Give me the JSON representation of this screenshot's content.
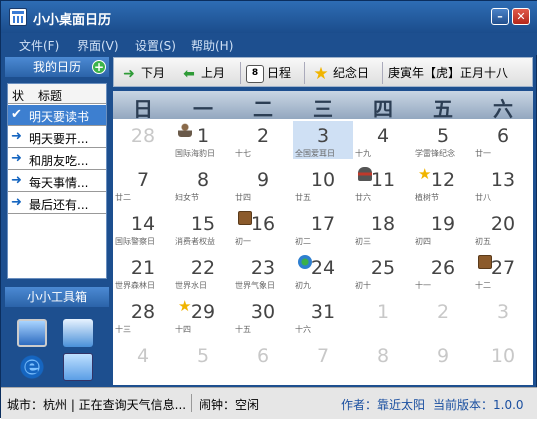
{
  "window": {
    "title": "小小桌面日历"
  },
  "menu": [
    "文件(F)",
    "界面(V)",
    "设置(S)",
    "帮助(H)"
  ],
  "my_calendar": {
    "header": "我的日历",
    "columns": [
      "状",
      "标题"
    ],
    "items": [
      {
        "status": "check-icon",
        "title": "明天要读书",
        "selected": true
      },
      {
        "status": "arrow-icon",
        "title": "明天要开..."
      },
      {
        "status": "arrow-icon",
        "title": "和朋友吃..."
      },
      {
        "status": "arrow-icon",
        "title": "每天事情..."
      },
      {
        "status": "arrow-icon",
        "title": "最后还有..."
      }
    ]
  },
  "toolbox": {
    "header": "小小工具箱",
    "tools": [
      "monitor-icon",
      "control-panel-icon",
      "ie-icon",
      "window-icon",
      "color-cubes-icon",
      "chart-monitor-icon"
    ]
  },
  "toolbar": {
    "next_month": "下月",
    "prev_month": "上月",
    "schedule": "日程",
    "schedule_icon_text": "8",
    "anniversary": "纪念日",
    "lunar_header": "庚寅年【虎】正月十八"
  },
  "weekdays": [
    "日",
    "一",
    "二",
    "三",
    "四",
    "五",
    "六"
  ],
  "calendar": {
    "weeks": [
      [
        {
          "d": "28",
          "o": true
        },
        {
          "d": "1",
          "l": "国际海豹日",
          "m": "person"
        },
        {
          "d": "2",
          "l": "十七"
        },
        {
          "d": "3",
          "l": "全国爱耳日",
          "today": true
        },
        {
          "d": "4",
          "l": "十九"
        },
        {
          "d": "5",
          "l": "学雷锋纪念"
        },
        {
          "d": "6",
          "l": "廿一"
        }
      ],
      [
        {
          "d": "7",
          "l": "廿二"
        },
        {
          "d": "8",
          "l": "妇女节"
        },
        {
          "d": "9",
          "l": "廿四"
        },
        {
          "d": "10",
          "l": "廿五"
        },
        {
          "d": "11",
          "l": "廿六",
          "m": "hat"
        },
        {
          "d": "12",
          "l": "植树节",
          "m": "star"
        },
        {
          "d": "13",
          "l": "廿八"
        }
      ],
      [
        {
          "d": "14",
          "l": "国际警察日"
        },
        {
          "d": "15",
          "l": "消费者权益"
        },
        {
          "d": "16",
          "l": "初一",
          "m": "book"
        },
        {
          "d": "17",
          "l": "初二"
        },
        {
          "d": "18",
          "l": "初三"
        },
        {
          "d": "19",
          "l": "初四"
        },
        {
          "d": "20",
          "l": "初五"
        }
      ],
      [
        {
          "d": "21",
          "l": "世界森林日"
        },
        {
          "d": "22",
          "l": "世界水日"
        },
        {
          "d": "23",
          "l": "世界气象日"
        },
        {
          "d": "24",
          "l": "初九",
          "m": "globe"
        },
        {
          "d": "25",
          "l": "初十"
        },
        {
          "d": "26",
          "l": "十一"
        },
        {
          "d": "27",
          "l": "十二",
          "m": "book"
        }
      ],
      [
        {
          "d": "28",
          "l": "十三"
        },
        {
          "d": "29",
          "l": "十四",
          "m": "star"
        },
        {
          "d": "30",
          "l": "十五"
        },
        {
          "d": "31",
          "l": "十六"
        },
        {
          "d": "1",
          "o": true
        },
        {
          "d": "2",
          "o": true
        },
        {
          "d": "3",
          "o": true
        }
      ],
      [
        {
          "d": "4",
          "o": true
        },
        {
          "d": "5",
          "o": true
        },
        {
          "d": "6",
          "o": true
        },
        {
          "d": "7",
          "o": true
        },
        {
          "d": "8",
          "o": true
        },
        {
          "d": "9",
          "o": true
        },
        {
          "d": "10",
          "o": true
        }
      ]
    ]
  },
  "status": {
    "city": "城市：杭州 | 正在查询天气信息...",
    "alarm": "闹钟：空闲",
    "author": "作者：靠近太阳",
    "version": "当前版本：1.0.0"
  },
  "colors": {
    "title_bar": "#1b4d8c",
    "accent": "#3d7fd0",
    "today_bg": "#cfe0f4"
  }
}
